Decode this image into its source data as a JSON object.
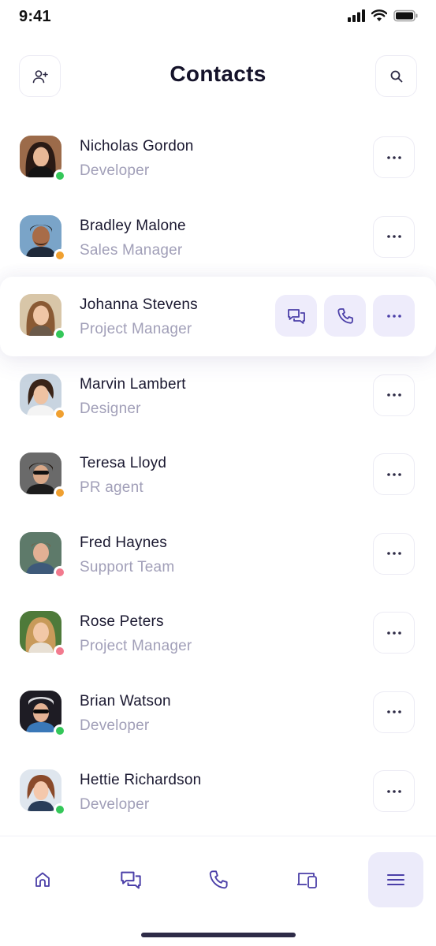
{
  "status_bar": {
    "time": "9:41"
  },
  "header": {
    "title": "Contacts",
    "left_icon": "add-user-icon",
    "right_icon": "search-icon"
  },
  "colors": {
    "accent": "#4b3fa8",
    "accent_soft": "#eeecfb",
    "online": "#34c759",
    "away": "#f0a030",
    "busy": "#f27a8e",
    "muted_text": "#a19fb8"
  },
  "contacts": [
    {
      "name": "Nicholas Gordon",
      "role": "Developer",
      "status": "online"
    },
    {
      "name": "Bradley Malone",
      "role": "Sales Manager",
      "status": "away"
    },
    {
      "name": "Johanna Stevens",
      "role": "Project Manager",
      "status": "online",
      "selected": true
    },
    {
      "name": "Marvin Lambert",
      "role": "Designer",
      "status": "away"
    },
    {
      "name": "Teresa Lloyd",
      "role": "PR agent",
      "status": "away"
    },
    {
      "name": "Fred Haynes",
      "role": "Support Team",
      "status": "busy"
    },
    {
      "name": "Rose Peters",
      "role": "Project Manager",
      "status": "busy"
    },
    {
      "name": "Brian Watson",
      "role": "Developer",
      "status": "online"
    },
    {
      "name": "Hettie Richardson",
      "role": "Developer",
      "status": "online"
    }
  ],
  "tab_bar": [
    {
      "icon": "home-icon",
      "active": false
    },
    {
      "icon": "chat-icon",
      "active": false
    },
    {
      "icon": "phone-icon",
      "active": false
    },
    {
      "icon": "devices-icon",
      "active": false
    },
    {
      "icon": "menu-icon",
      "active": true
    }
  ]
}
